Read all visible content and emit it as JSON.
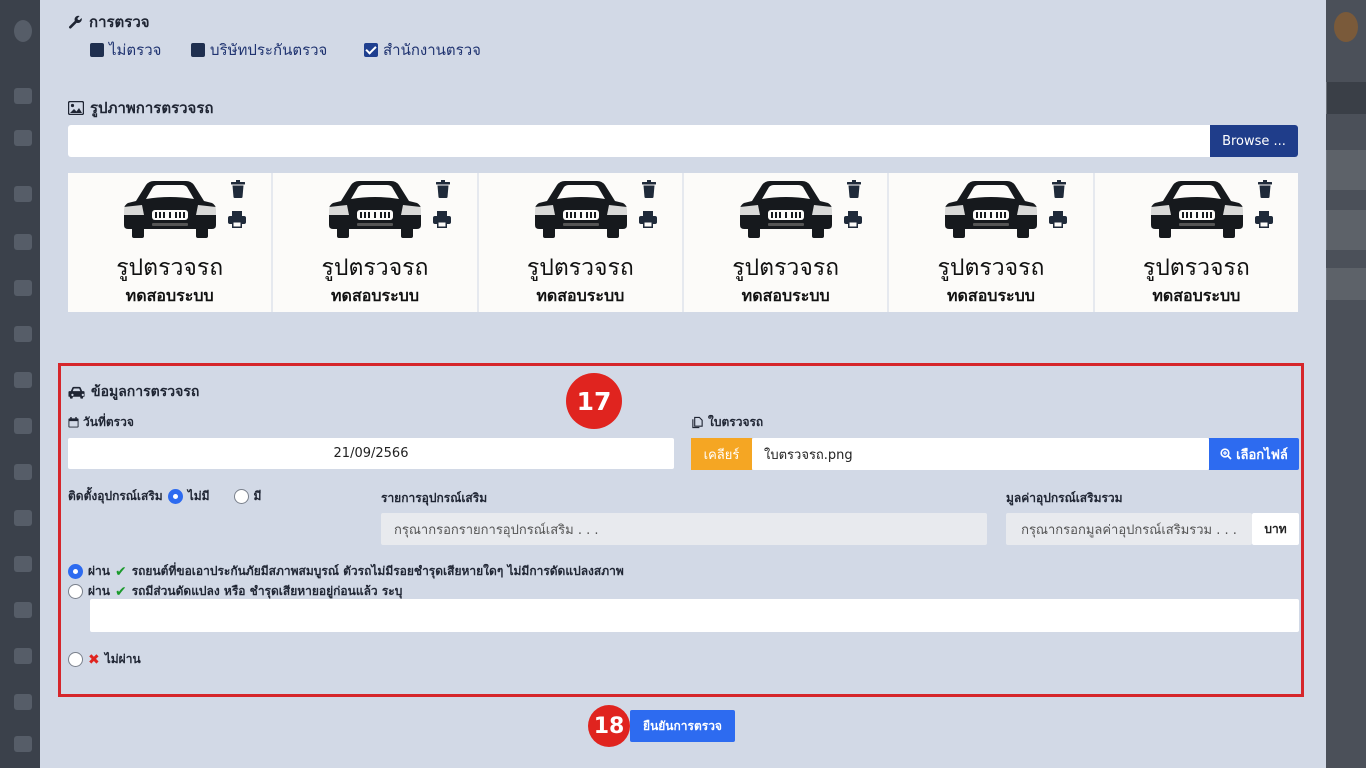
{
  "inspection_type": {
    "title": "การตรวจ",
    "options": [
      {
        "label": "ไม่ตรวจ",
        "checked": false
      },
      {
        "label": "บริษัทประกันตรวจ",
        "checked": false
      },
      {
        "label": "สำนักงานตรวจ",
        "checked": true
      }
    ]
  },
  "photos": {
    "title": "รูปภาพการตรวจรถ",
    "browse_label": "Browse ...",
    "cards": [
      {
        "caption": "รูปตรวจรถ",
        "subcaption": "ทดสอบระบบ"
      },
      {
        "caption": "รูปตรวจรถ",
        "subcaption": "ทดสอบระบบ"
      },
      {
        "caption": "รูปตรวจรถ",
        "subcaption": "ทดสอบระบบ"
      },
      {
        "caption": "รูปตรวจรถ",
        "subcaption": "ทดสอบระบบ"
      },
      {
        "caption": "รูปตรวจรถ",
        "subcaption": "ทดสอบระบบ"
      },
      {
        "caption": "รูปตรวจรถ",
        "subcaption": "ทดสอบระบบ"
      }
    ]
  },
  "inspection_info": {
    "title": "ข้อมูลการตรวจรถ",
    "step_badge": "17",
    "date_label": "วันที่ตรวจ",
    "date_value": "21/09/2566",
    "doc_label": "ใบตรวจรถ",
    "clear_label": "เคลียร์",
    "file_name": "ใบตรวจรถ.png",
    "choose_file_label": "เลือกไฟล์",
    "accessory_label": "ติดตั้งอุปกรณ์เสริม",
    "accessory_no": "ไม่มี",
    "accessory_yes": "มี",
    "accessory_list_label": "รายการอุปกรณ์เสริม",
    "accessory_list_placeholder": "กรุณากรอกรายการอุปกรณ์เสริม . . .",
    "accessory_value_label": "มูลค่าอุปกรณ์เสริมรวม",
    "accessory_value_placeholder": "กรุณากรอกมูลค่าอุปกรณ์เสริมรวม . . .",
    "currency_unit": "บาท",
    "result_pass_label": "ผ่าน",
    "result_pass_text": "รถยนต์ที่ขอเอาประกันภัยมีสภาพสมบูรณ์ ตัวรถไม่มีรอยชำรุดเสียหายใดๆ ไม่มีการดัดแปลงสภาพ",
    "result_pass_mod_label": "ผ่าน",
    "result_pass_mod_text": "รถมีส่วนดัดแปลง หรือ ชำรุดเสียหายอยู่ก่อนแล้ว ระบุ",
    "result_fail_label": "ไม่ผ่าน"
  },
  "confirm": {
    "step_badge": "18",
    "label": "ยืนยันการตรวจ"
  },
  "colors": {
    "modal_bg": "#d2d9e6",
    "primary": "#2d6bf0",
    "navy": "#1f3d8a",
    "highlight": "#d6262b",
    "warning": "#f5a623"
  }
}
